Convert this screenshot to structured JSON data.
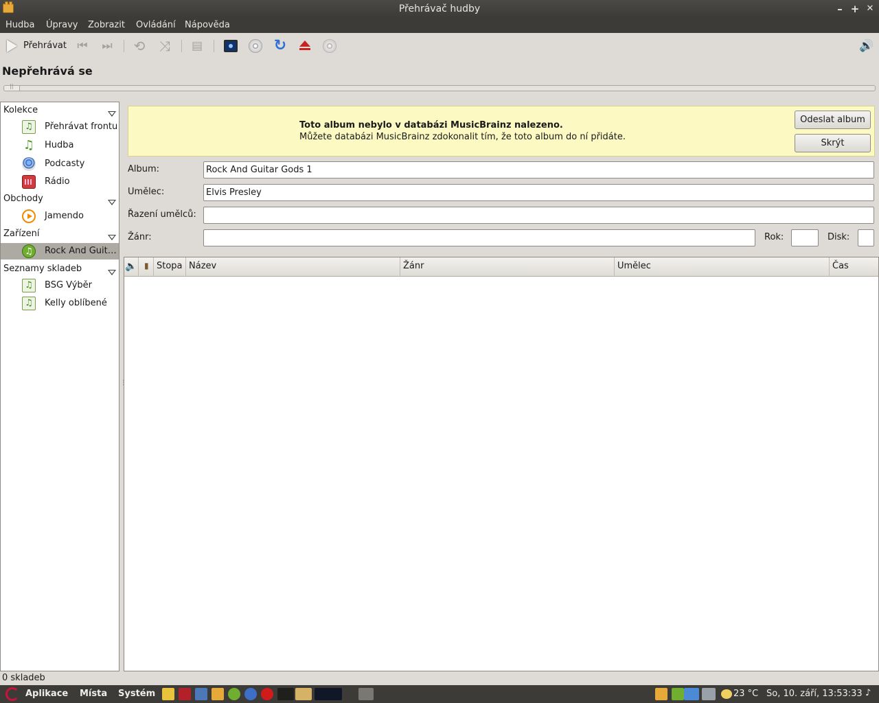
{
  "window": {
    "title": "Přehrávač hudby",
    "minimize": "–",
    "maximize": "+",
    "close": "✕"
  },
  "menu": [
    "Hudba",
    "Úpravy",
    "Zobrazit",
    "Ovládání",
    "Nápověda"
  ],
  "toolbar": {
    "play_label": "Přehrávat",
    "icons": [
      "play-icon",
      "previous-icon",
      "next-icon",
      "repeat-icon",
      "shuffle-icon",
      "browse-icon",
      "visualization-icon",
      "cd-icon",
      "refresh-icon",
      "eject-icon",
      "disc-icon",
      "volume-icon"
    ],
    "prev_glyph": "⏮",
    "next_glyph": "⏭",
    "repeat_glyph": "⟲",
    "shuffle_glyph": "⤨",
    "browse_glyph": "▤",
    "refresh_glyph": "↻",
    "volume_glyph": "🔊"
  },
  "now_playing": {
    "title": "Nepřehrává se",
    "progress": 0
  },
  "sidebar": {
    "categories": [
      {
        "label": "Kolekce",
        "items": [
          {
            "label": "Přehrávat frontu",
            "icon": "queue-icon",
            "glyph": "♫"
          },
          {
            "label": "Hudba",
            "icon": "music-icon",
            "glyph": "♫"
          },
          {
            "label": "Podcasty",
            "icon": "podcast-icon",
            "glyph": ""
          },
          {
            "label": "Rádio",
            "icon": "radio-icon",
            "glyph": ""
          }
        ]
      },
      {
        "label": "Obchody",
        "items": [
          {
            "label": "Jamendo",
            "icon": "jamendo-icon",
            "glyph": ""
          }
        ]
      },
      {
        "label": "Zařízení",
        "items": [
          {
            "label": "Rock And Guit…",
            "icon": "audio-cd-icon",
            "glyph": "♫",
            "selected": true
          }
        ]
      },
      {
        "label": "Seznamy skladeb",
        "items": [
          {
            "label": "BSG Výběr",
            "icon": "playlist-icon",
            "glyph": "♫"
          },
          {
            "label": "Kelly oblíbené",
            "icon": "playlist-icon",
            "glyph": "♫"
          }
        ]
      }
    ]
  },
  "infobar": {
    "title": "Toto album nebylo v databázi MusicBrainz nalezeno.",
    "message": "Můžete databázi MusicBrainz zdokonalit tím, že toto album do ní přidáte.",
    "send_button": "Odeslat album",
    "hide_button": "Skrýt",
    "background": "#fcfac2"
  },
  "form": {
    "album_label": "Album:",
    "album_value": "Rock And Guitar Gods 1",
    "artist_label": "Umělec:",
    "artist_value": "Elvis Presley",
    "artist_sort_label": "Řazení umělců:",
    "artist_sort_value": "",
    "genre_label": "Žánr:",
    "genre_value": "",
    "year_label": "Rok:",
    "year_value": "",
    "disc_label": "Disk:",
    "disc_value": ""
  },
  "tracklist": {
    "columns": [
      "",
      "",
      "Stopa",
      "Název",
      "Žánr",
      "Umělec",
      "Čas"
    ],
    "icon_col_glyph": "🔈",
    "check_col_glyph": "▮",
    "rows": []
  },
  "status": {
    "text": "0 skladeb"
  },
  "taskbar": {
    "menus": [
      "Aplikace",
      "Místa",
      "Systém"
    ],
    "temperature": "23 °C",
    "clock": "So, 10. září, 13:53:33"
  }
}
